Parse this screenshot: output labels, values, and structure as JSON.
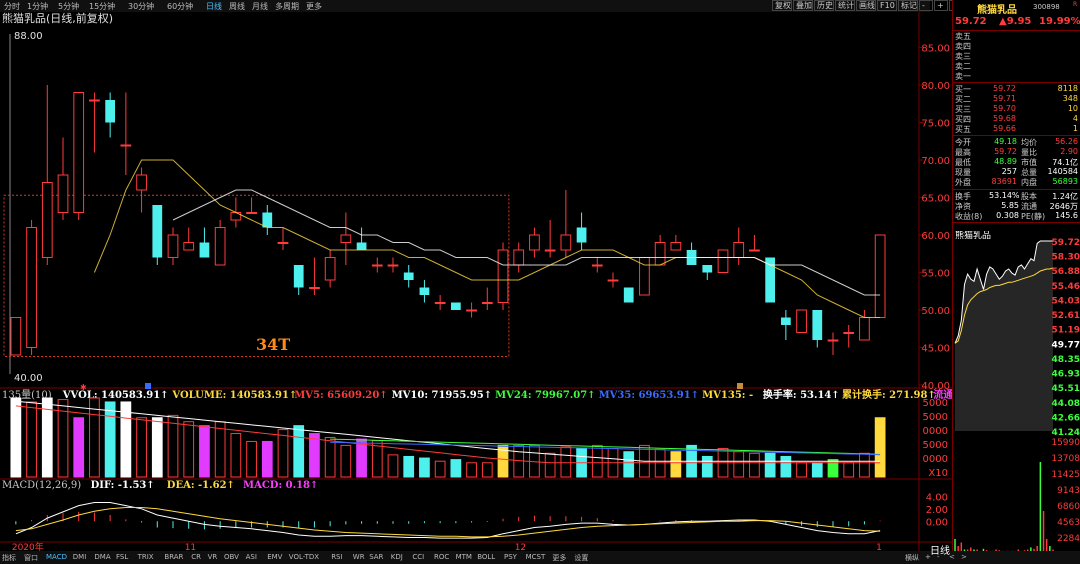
{
  "toolbar": {
    "timeframes": [
      {
        "label": "分时",
        "active": false
      },
      {
        "label": "1分钟",
        "active": false
      },
      {
        "label": "5分钟",
        "active": false
      },
      {
        "label": "15分钟",
        "active": false
      },
      {
        "label": "30分钟",
        "active": false
      },
      {
        "label": "60分钟",
        "active": false
      },
      {
        "label": "日线",
        "active": true
      },
      {
        "label": "周线",
        "active": false
      },
      {
        "label": "月线",
        "active": false
      },
      {
        "label": "多周期",
        "active": false
      },
      {
        "label": "更多",
        "active": false
      }
    ],
    "buttons": [
      "复权",
      "叠加",
      "历史",
      "统计",
      "画线",
      "F10",
      "标记",
      "-",
      "+",
      "x"
    ]
  },
  "chart_data": [
    {
      "type": "candlestick",
      "title": "熊猫乳品(日线,前复权)",
      "ylim": [
        40,
        88
      ],
      "y_ticks": [
        "85.00",
        "80.00",
        "75.00",
        "70.00",
        "65.00",
        "60.00",
        "55.00",
        "50.00",
        "45.00",
        "40.00"
      ],
      "top_label": "88.00",
      "bottom_label": "40.00",
      "x_labels": [
        {
          "label": "2020年",
          "index": 0
        },
        {
          "label": "11",
          "index": 11
        },
        {
          "label": "12",
          "index": 32
        },
        {
          "label": "1",
          "index": 55
        }
      ],
      "box_label": "34T",
      "candles": [
        {
          "o": 44,
          "h": 49,
          "l": 44,
          "c": 49
        },
        {
          "o": 45,
          "h": 62,
          "l": 44,
          "c": 61
        },
        {
          "o": 57,
          "h": 80,
          "l": 56,
          "c": 67
        },
        {
          "o": 63,
          "h": 73,
          "l": 62,
          "c": 68
        },
        {
          "o": 63,
          "h": 75,
          "l": 62,
          "c": 79
        },
        {
          "o": 78,
          "h": 79,
          "l": 71,
          "c": 78
        },
        {
          "o": 78,
          "h": 79,
          "l": 73,
          "c": 75
        },
        {
          "o": 72,
          "h": 79,
          "l": 68,
          "c": 72
        },
        {
          "o": 66,
          "h": 69,
          "l": 63,
          "c": 68
        },
        {
          "o": 64,
          "h": 64,
          "l": 56,
          "c": 57
        },
        {
          "o": 57,
          "h": 61,
          "l": 56,
          "c": 60
        },
        {
          "o": 58,
          "h": 61,
          "l": 58,
          "c": 59
        },
        {
          "o": 59,
          "h": 61,
          "l": 57,
          "c": 57
        },
        {
          "o": 56,
          "h": 62,
          "l": 56,
          "c": 61
        },
        {
          "o": 62,
          "h": 65,
          "l": 61,
          "c": 63
        },
        {
          "o": 63,
          "h": 65,
          "l": 63,
          "c": 63
        },
        {
          "o": 63,
          "h": 64,
          "l": 60,
          "c": 61
        },
        {
          "o": 59,
          "h": 61,
          "l": 58,
          "c": 59
        },
        {
          "o": 56,
          "h": 56,
          "l": 52,
          "c": 53
        },
        {
          "o": 53,
          "h": 57,
          "l": 52,
          "c": 53
        },
        {
          "o": 54,
          "h": 58,
          "l": 53,
          "c": 57
        },
        {
          "o": 59,
          "h": 63,
          "l": 56,
          "c": 60
        },
        {
          "o": 59,
          "h": 61,
          "l": 58,
          "c": 58
        },
        {
          "o": 56,
          "h": 57,
          "l": 55,
          "c": 56
        },
        {
          "o": 56,
          "h": 57,
          "l": 55,
          "c": 56
        },
        {
          "o": 55,
          "h": 56,
          "l": 53,
          "c": 54
        },
        {
          "o": 53,
          "h": 54,
          "l": 51,
          "c": 52
        },
        {
          "o": 51,
          "h": 52,
          "l": 50,
          "c": 51
        },
        {
          "o": 51,
          "h": 51,
          "l": 50,
          "c": 50
        },
        {
          "o": 50,
          "h": 51,
          "l": 49,
          "c": 50
        },
        {
          "o": 51,
          "h": 53,
          "l": 50,
          "c": 51
        },
        {
          "o": 51,
          "h": 59,
          "l": 50,
          "c": 58
        },
        {
          "o": 56,
          "h": 59,
          "l": 55,
          "c": 58
        },
        {
          "o": 58,
          "h": 61,
          "l": 57,
          "c": 60
        },
        {
          "o": 58,
          "h": 62,
          "l": 57,
          "c": 58
        },
        {
          "o": 58,
          "h": 66,
          "l": 57,
          "c": 60
        },
        {
          "o": 61,
          "h": 63,
          "l": 58,
          "c": 59
        },
        {
          "o": 56,
          "h": 57,
          "l": 55,
          "c": 56
        },
        {
          "o": 54,
          "h": 55,
          "l": 53,
          "c": 54
        },
        {
          "o": 53,
          "h": 53,
          "l": 51,
          "c": 51
        },
        {
          "o": 52,
          "h": 57,
          "l": 52,
          "c": 57
        },
        {
          "o": 56,
          "h": 60,
          "l": 56,
          "c": 59
        },
        {
          "o": 58,
          "h": 60,
          "l": 58,
          "c": 59
        },
        {
          "o": 58,
          "h": 59,
          "l": 56,
          "c": 56
        },
        {
          "o": 56,
          "h": 56,
          "l": 54,
          "c": 55
        },
        {
          "o": 55,
          "h": 58,
          "l": 55,
          "c": 58
        },
        {
          "o": 57,
          "h": 61,
          "l": 56,
          "c": 59
        },
        {
          "o": 58,
          "h": 60,
          "l": 58,
          "c": 58
        },
        {
          "o": 57,
          "h": 57,
          "l": 51,
          "c": 51
        },
        {
          "o": 49,
          "h": 50,
          "l": 46,
          "c": 48
        },
        {
          "o": 47,
          "h": 50,
          "l": 47,
          "c": 50
        },
        {
          "o": 50,
          "h": 50,
          "l": 45,
          "c": 46
        },
        {
          "o": 46,
          "h": 47,
          "l": 44,
          "c": 46
        },
        {
          "o": 47,
          "h": 48,
          "l": 45,
          "c": 47
        },
        {
          "o": 46,
          "h": 50,
          "l": 46,
          "c": 49
        },
        {
          "o": 49,
          "h": 60,
          "l": 49,
          "c": 60
        }
      ],
      "ma_lines": [
        {
          "color": "#ffd93d",
          "values": [
            null,
            null,
            null,
            null,
            null,
            55,
            60,
            66,
            70,
            70,
            70,
            68,
            66,
            64,
            63,
            62,
            61,
            61,
            60,
            59,
            58,
            58,
            58,
            58,
            58,
            57,
            57,
            56,
            55,
            54,
            54,
            54,
            54,
            55,
            56,
            57,
            58,
            58,
            58,
            57,
            56,
            56,
            57,
            57,
            57,
            57,
            57,
            57,
            56,
            55,
            54,
            52,
            51,
            50,
            49,
            49
          ]
        },
        {
          "color": "#ffffff",
          "values": [
            null,
            null,
            null,
            null,
            null,
            null,
            null,
            null,
            null,
            null,
            62,
            63,
            64,
            65,
            66,
            66,
            65,
            64,
            63,
            62,
            61,
            61,
            60,
            60,
            59,
            59,
            58,
            58,
            57,
            57,
            57,
            56,
            56,
            56,
            56,
            56,
            57,
            57,
            57,
            57,
            57,
            57,
            57,
            57,
            57,
            57,
            57,
            57,
            56,
            56,
            56,
            55,
            54,
            53,
            52,
            52
          ]
        }
      ]
    },
    {
      "type": "bar",
      "name": "volume",
      "header": [
        {
          "text": "135量(10)",
          "color": "#c8c8c8"
        },
        {
          "text": "VVOL: 140583.91↑",
          "color": "#ffffff"
        },
        {
          "text": "VOLUME: 140583.91↑",
          "color": "#ffd93d"
        },
        {
          "text": "MV5: 65609.20↑",
          "color": "#ff3b3b"
        },
        {
          "text": "MV10: 71955.95↑",
          "color": "#ffffff"
        },
        {
          "text": "MV24: 79967.07↑",
          "color": "#3cff3c"
        },
        {
          "text": "MV35: 69653.91↑",
          "color": "#3a6bff"
        },
        {
          "text": "MV135: -",
          "color": "#ffd93d"
        },
        {
          "text": "换手率: 53.14↑",
          "color": "#ffffff"
        },
        {
          "text": "累计换手: 271.98↑",
          "color": "#ffd93d"
        },
        {
          "text": "流通股",
          "color": "#ff3bff"
        }
      ],
      "y_ticks": [
        "5000",
        "5000",
        "0000",
        "5000",
        "0000",
        "X10"
      ],
      "values": [
        100,
        95,
        100,
        98,
        75,
        100,
        95,
        95,
        75,
        75,
        78,
        70,
        65,
        70,
        55,
        45,
        45,
        60,
        65,
        55,
        50,
        40,
        48,
        46,
        28,
        26,
        24,
        20,
        22,
        18,
        18,
        40,
        40,
        40,
        30,
        38,
        36,
        40,
        36,
        32,
        40,
        35,
        32,
        40,
        26,
        36,
        32,
        30,
        30,
        26,
        18,
        18,
        22,
        18,
        30,
        75
      ],
      "ylim": [
        0,
        100
      ]
    },
    {
      "type": "line",
      "name": "macd",
      "header": [
        {
          "text": "MACD(12,26,9)",
          "color": "#c8c8c8"
        },
        {
          "text": "DIF: -1.53↑",
          "color": "#ffffff"
        },
        {
          "text": "DEA: -1.62↑",
          "color": "#ffd93d"
        },
        {
          "text": "MACD: 0.18↑",
          "color": "#ff3bff"
        }
      ],
      "y_ticks": [
        "4.00",
        "2.00",
        "0.00"
      ],
      "ylim": [
        -3,
        5
      ],
      "dif": [
        -2,
        -1,
        0.5,
        1.5,
        2.5,
        3,
        3,
        2.5,
        2,
        1,
        0.5,
        0,
        -0.5,
        -0.8,
        -1,
        -1.2,
        -1.5,
        -1.8,
        -2.2,
        -2.4,
        -2.4,
        -2.3,
        -2.3,
        -2.4,
        -2.5,
        -2.6,
        -2.6,
        -2.7,
        -2.7,
        -2.7,
        -2.6,
        -2,
        -1.5,
        -1,
        -0.8,
        -0.5,
        -0.3,
        -0.3,
        -0.5,
        -0.6,
        -0.5,
        -0.3,
        -0.1,
        0,
        0,
        0.1,
        0.2,
        0.2,
        0,
        -0.5,
        -1,
        -1.5,
        -1.8,
        -2,
        -2,
        -1.5
      ],
      "dea": [
        -1.5,
        -1.2,
        -0.5,
        0.2,
        1,
        1.6,
        2,
        2.2,
        2.2,
        2,
        1.6,
        1.2,
        0.8,
        0.4,
        0.1,
        -0.2,
        -0.5,
        -0.8,
        -1.1,
        -1.4,
        -1.6,
        -1.8,
        -1.9,
        -2,
        -2.1,
        -2.2,
        -2.3,
        -2.4,
        -2.4,
        -2.5,
        -2.5,
        -2.4,
        -2.2,
        -1.9,
        -1.6,
        -1.3,
        -1,
        -0.8,
        -0.7,
        -0.6,
        -0.5,
        -0.4,
        -0.3,
        -0.2,
        -0.1,
        0,
        0,
        0.1,
        0.1,
        0,
        -0.3,
        -0.6,
        -0.9,
        -1.2,
        -1.5,
        -1.6
      ],
      "hist": [
        -0.5,
        0.2,
        1,
        1.3,
        1.5,
        1.4,
        1,
        0.3,
        -0.2,
        -1,
        -1.1,
        -1.2,
        -1.3,
        -1.2,
        -1.1,
        -1,
        -1,
        -1,
        -1.1,
        -1,
        -0.8,
        -0.5,
        -0.4,
        -0.4,
        -0.4,
        -0.4,
        -0.3,
        -0.3,
        -0.3,
        -0.2,
        -0.1,
        0.4,
        0.7,
        0.9,
        0.8,
        0.8,
        0.7,
        0.5,
        0.2,
        0,
        0,
        0.1,
        0.2,
        0.2,
        0.1,
        0.1,
        0.2,
        0.1,
        -0.1,
        -0.5,
        -0.7,
        -0.9,
        -0.9,
        -0.8,
        -0.5,
        0.1
      ]
    },
    {
      "type": "area",
      "name": "intraday",
      "title": "熊猫乳品",
      "y_ticks": [
        "59.72",
        "58.30",
        "56.88",
        "55.46",
        "54.03",
        "52.61",
        "51.19",
        "49.77",
        "48.35",
        "46.93",
        "45.51",
        "44.08",
        "42.66",
        "41.24"
      ],
      "ylim": [
        41.24,
        59.72
      ],
      "base": 49.77,
      "price": [
        49.77,
        50.5,
        52,
        55.5,
        56.5,
        56,
        55.8,
        57,
        56,
        55,
        56.5,
        57.2,
        57,
        56.5,
        56,
        56.3,
        56.8,
        57,
        56.6,
        56.4,
        57.2,
        57.4,
        57,
        57.5,
        58,
        57.8,
        59.5,
        59.72,
        59.72,
        59.72,
        59.72,
        59.72
      ],
      "avg": [
        49.77,
        50,
        51,
        52.5,
        53.5,
        54,
        54.3,
        54.6,
        54.8,
        54.9,
        55,
        55.2,
        55.3,
        55.4,
        55.4,
        55.5,
        55.6,
        55.7,
        55.7,
        55.8,
        55.9,
        56,
        56.1,
        56.2,
        56.3,
        56.4,
        56.6,
        56.8,
        56.9,
        57,
        57,
        57.1
      ]
    },
    {
      "type": "bar",
      "name": "intraday-volume",
      "y_ticks": [
        "15990",
        "13708",
        "11425",
        "9143",
        "6860",
        "4563",
        "2284"
      ],
      "values": [
        2,
        1,
        1.5,
        0.5,
        0.5,
        0.8,
        0.5,
        0.5,
        0.3,
        0.6,
        0.4,
        0.3,
        0.3,
        0.5,
        0.4,
        0.3,
        0.2,
        0.2,
        0.3,
        0.3,
        0.5,
        0.3,
        0.4,
        0.5,
        0.8,
        0.6,
        1,
        13,
        6,
        2,
        1,
        0.5
      ],
      "ylim": [
        0,
        16
      ]
    }
  ],
  "side": {
    "stock_name": "熊猫乳品",
    "stock_code": "300898",
    "last_price": "59.72",
    "change": "▲9.95",
    "change_pct": "19.99%",
    "sell_levels": [
      {
        "label": "卖五"
      },
      {
        "label": "卖四"
      },
      {
        "label": "卖三"
      },
      {
        "label": "卖二"
      },
      {
        "label": "卖一"
      }
    ],
    "buy_levels": [
      {
        "label": "买一",
        "price": "59.72",
        "vol": "8118"
      },
      {
        "label": "买二",
        "price": "59.71",
        "vol": "348"
      },
      {
        "label": "买三",
        "price": "59.70",
        "vol": "10"
      },
      {
        "label": "买四",
        "price": "59.68",
        "vol": "4"
      },
      {
        "label": "买五",
        "price": "59.66",
        "vol": "1"
      }
    ],
    "stats": [
      {
        "l1": "今开",
        "v1": "49.18",
        "c1": "green",
        "l2": "均价",
        "v2": "56.26",
        "c2": "red"
      },
      {
        "l1": "最高",
        "v1": "59.72",
        "c1": "red",
        "l2": "量比",
        "v2": "2.90",
        "c2": "red"
      },
      {
        "l1": "最低",
        "v1": "48.89",
        "c1": "green",
        "l2": "市值",
        "v2": "74.1亿",
        "c2": "white"
      },
      {
        "l1": "现量",
        "v1": "257",
        "c1": "white",
        "l2": "总量",
        "v2": "140584",
        "c2": "white"
      },
      {
        "l1": "外盘",
        "v1": "83691",
        "c1": "red",
        "l2": "内盘",
        "v2": "56893",
        "c2": "green"
      }
    ],
    "stats2": [
      {
        "l1": "换手",
        "v1": "53.14%",
        "l2": "股本",
        "v2": "1.24亿"
      },
      {
        "l1": "净资",
        "v1": "5.85",
        "l2": "流通",
        "v2": "2646万"
      },
      {
        "l1": "收益(8)",
        "v1": "0.308",
        "l2": "PE(静)",
        "v2": "145.6"
      }
    ]
  },
  "bottom": {
    "items": [
      {
        "label": "指标",
        "active": false
      },
      {
        "label": "窗口",
        "active": false
      },
      {
        "label": "MACD",
        "active": true
      },
      {
        "label": "DMI",
        "active": false
      },
      {
        "label": "DMA",
        "active": false
      },
      {
        "label": "FSL",
        "active": false
      },
      {
        "label": "TRIX",
        "active": false
      },
      {
        "label": "BRAR",
        "active": false
      },
      {
        "label": "CR",
        "active": false
      },
      {
        "label": "VR",
        "active": false
      },
      {
        "label": "OBV",
        "active": false
      },
      {
        "label": "ASI",
        "active": false
      },
      {
        "label": "EMV",
        "active": false
      },
      {
        "label": "VOL-TDX",
        "active": false
      },
      {
        "label": "RSI",
        "active": false
      },
      {
        "label": "WR",
        "active": false
      },
      {
        "label": "SAR",
        "active": false
      },
      {
        "label": "KDJ",
        "active": false
      },
      {
        "label": "CCI",
        "active": false
      },
      {
        "label": "ROC",
        "active": false
      },
      {
        "label": "MTM",
        "active": false
      },
      {
        "label": "BOLL",
        "active": false
      },
      {
        "label": "PSY",
        "active": false
      },
      {
        "label": "MCST",
        "active": false
      },
      {
        "label": "更多",
        "active": false
      },
      {
        "label": "设置",
        "active": false
      }
    ],
    "right_tabs": [
      "横纵",
      "+",
      "-",
      "<",
      ">"
    ],
    "daily_label": "日线"
  }
}
